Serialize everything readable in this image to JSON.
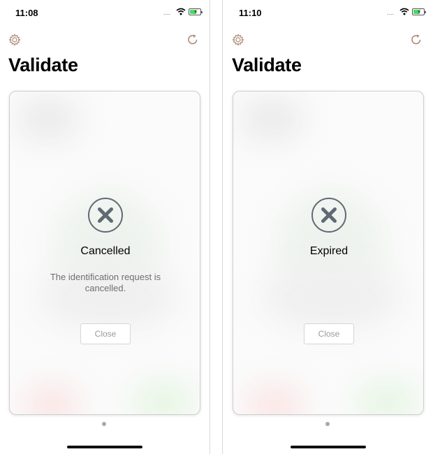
{
  "screens": [
    {
      "status_time": "11:08",
      "status_dots": "....",
      "title": "Validate",
      "status_title": "Cancelled",
      "status_message": "The identification request is cancelled.",
      "close_label": "Close"
    },
    {
      "status_time": "11:10",
      "status_dots": "....",
      "title": "Validate",
      "status_title": "Expired",
      "status_message": "",
      "close_label": "Close"
    }
  ],
  "colors": {
    "accent_icon": "#b08a78",
    "status_icon": "#5f6a73",
    "battery_fill": "#4cd964"
  },
  "icons": {
    "settings": "gear-icon",
    "refresh": "refresh-icon",
    "status": "x-circle-icon"
  }
}
